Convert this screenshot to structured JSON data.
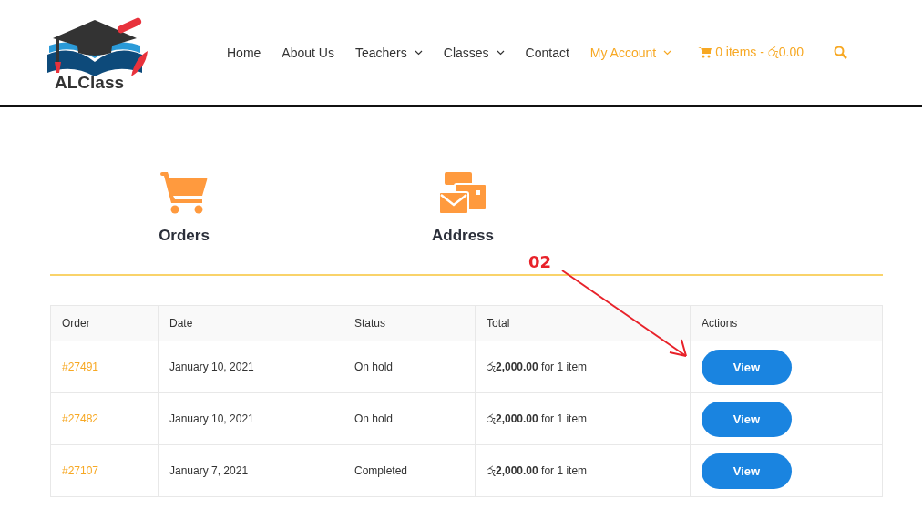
{
  "logo": {
    "text": "ALClass"
  },
  "nav": [
    {
      "label": "Home",
      "selected": false,
      "dropdown": false
    },
    {
      "label": "About Us",
      "selected": false,
      "dropdown": false
    },
    {
      "label": "Teachers",
      "selected": false,
      "dropdown": true
    },
    {
      "label": "Classes",
      "selected": false,
      "dropdown": true
    },
    {
      "label": "Contact",
      "selected": false,
      "dropdown": false
    },
    {
      "label": "My Account",
      "selected": true,
      "dropdown": true
    }
  ],
  "cart": {
    "label": "0 items - රු0.00"
  },
  "account_tabs": [
    {
      "label": "Orders",
      "kind": "cart"
    },
    {
      "label": "Address",
      "kind": "address"
    }
  ],
  "annotation": {
    "label": "02"
  },
  "table": {
    "columns": [
      "Order",
      "Date",
      "Status",
      "Total",
      "Actions"
    ],
    "rows": [
      {
        "order": "#27491",
        "date": "January 10, 2021",
        "status": "On hold",
        "total": "රු**2,000.00** for 1 item",
        "action": "View"
      },
      {
        "order": "#27482",
        "date": "January 10, 2021",
        "status": "On hold",
        "total": "රු**2,000.00** for 1 item",
        "action": "View"
      },
      {
        "order": "#27107",
        "date": "January 7, 2021",
        "status": "Completed",
        "total": "රු**2,000.00** for 1 item",
        "action": "View"
      }
    ]
  }
}
